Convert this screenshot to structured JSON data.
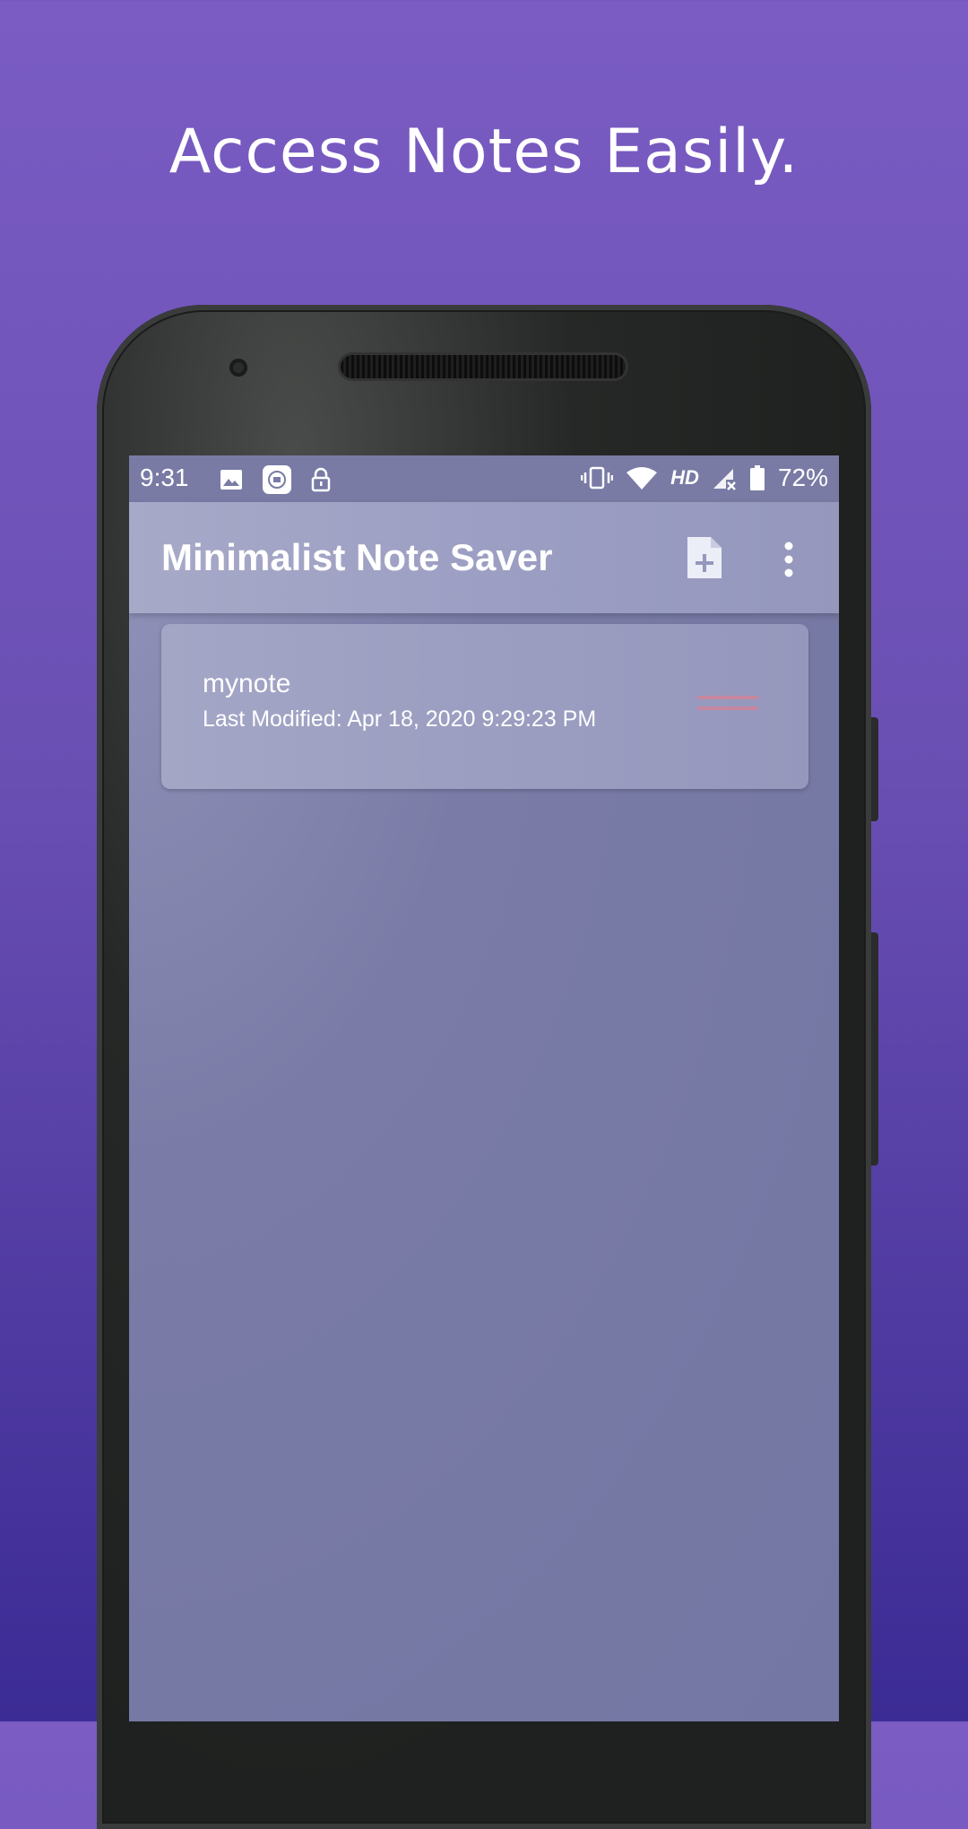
{
  "headline": "Access Notes Easily.",
  "status_bar": {
    "time": "9:31",
    "hd": "HD",
    "battery": "72%",
    "left_icons": [
      "image-icon",
      "app-notification-icon",
      "lock-icon"
    ],
    "right_icons": [
      "vibrate-icon",
      "wifi-icon",
      "signal-icon",
      "battery-icon"
    ]
  },
  "app_bar": {
    "title": "Minimalist Note Saver",
    "actions": [
      "new-note-icon",
      "overflow-menu-icon"
    ]
  },
  "notes": [
    {
      "title": "mynote",
      "modified": "Last Modified: Apr 18, 2020 9:29:23 PM"
    }
  ],
  "colors": {
    "background_top": "#7a5cc3",
    "background_bottom": "#3b2b94",
    "app_bar": "#a7a9c8",
    "screen": "#7678a4",
    "handle_accent": "#c7879e"
  }
}
